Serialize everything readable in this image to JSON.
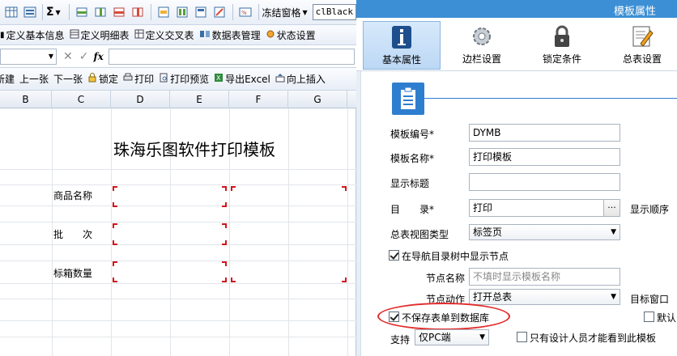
{
  "toolbar1": {
    "sigma_label": "Σ",
    "freeze_label": "冻结窗格",
    "color_value": "clBlack"
  },
  "toolbar2": {
    "items": [
      "定义基本信息",
      "定义明细表",
      "定义交叉表",
      "数据表管理",
      "状态设置"
    ]
  },
  "formula_bar": {
    "fx_label": "fx"
  },
  "toolbar4": {
    "items": [
      "新建",
      "上一张",
      "下一张",
      "锁定",
      "打印",
      "打印预览",
      "导出Excel",
      "向上插入"
    ]
  },
  "columns": [
    "B",
    "C",
    "D",
    "E",
    "F",
    "G"
  ],
  "sheet": {
    "title": "珠海乐图软件打印模板",
    "label_product": "商品名称",
    "label_batch": "批　　次",
    "label_qty": "标箱数量"
  },
  "panel": {
    "window_title": "模板属性",
    "tabs": [
      {
        "label": "基本属性",
        "icon": "info-icon"
      },
      {
        "label": "边栏设置",
        "icon": "gear-icon"
      },
      {
        "label": "锁定条件",
        "icon": "lock-icon"
      },
      {
        "label": "总表设置",
        "icon": "edit-document-icon"
      }
    ],
    "fields": {
      "code_label": "模板编号*",
      "code_value": "DYMB",
      "name_label": "模板名称*",
      "name_value": "打印模板",
      "display_title_label": "显示标题",
      "display_title_value": "",
      "catalog_label": "目　　录*",
      "catalog_value": "打印",
      "display_order_label": "显示顺序",
      "view_type_label": "总表视图类型",
      "view_type_value": "标签页",
      "show_in_tree_label": "在导航目录树中显示节点",
      "node_name_label": "节点名称",
      "node_name_placeholder": "不填时显示模板名称",
      "node_action_label": "节点动作",
      "node_action_value": "打开总表",
      "target_window_label": "目标窗口",
      "no_save_label": "不保存表单到数据库",
      "default_label": "默认",
      "support_label": "支持",
      "support_value": "仅PC端",
      "designer_only_label": "只有设计人员才能看到此模板"
    }
  }
}
